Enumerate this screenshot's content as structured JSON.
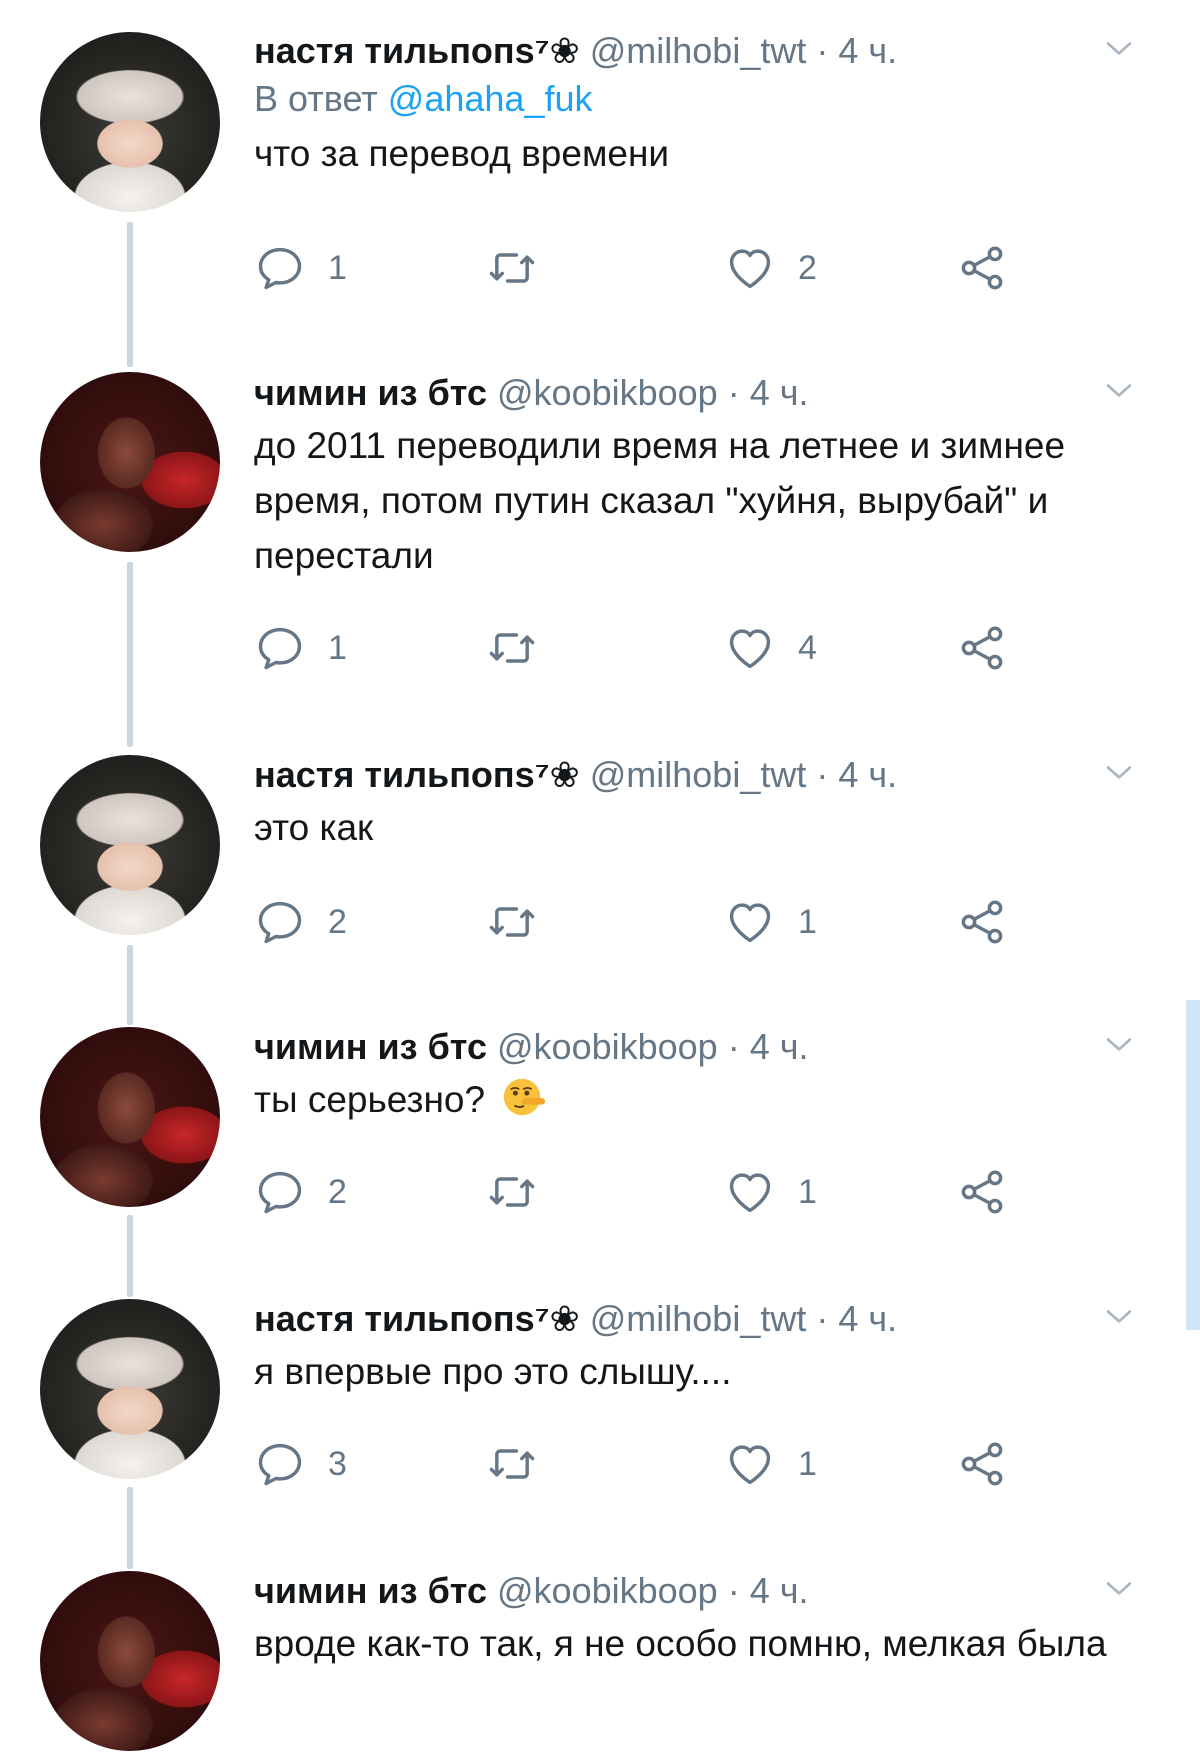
{
  "thread": {
    "tweets": [
      {
        "name": "настя тильпопs⁷❀",
        "handle": "@milhobi_twt",
        "time": "4 ч.",
        "dot": "·",
        "reply_prefix": "В ответ",
        "reply_mention": "@ahaha_fuk",
        "text": "что за перевод времени",
        "replies": "1",
        "retweets": "",
        "likes": "2",
        "avatar": "hobi"
      },
      {
        "name": "чимин из бтс",
        "handle": "@koobikboop",
        "time": "4 ч.",
        "dot": "·",
        "text": "до 2011 переводили время на летнее и зимнее время, потом путин сказал \"хуйня, вырубай\" и перестали",
        "replies": "1",
        "retweets": "",
        "likes": "4",
        "avatar": "jimin"
      },
      {
        "name": "настя тильпопs⁷❀",
        "handle": "@milhobi_twt",
        "time": "4 ч.",
        "dot": "·",
        "text": "это как",
        "replies": "2",
        "retweets": "",
        "likes": "1",
        "avatar": "hobi"
      },
      {
        "name": "чимин из бтс",
        "handle": "@koobikboop",
        "time": "4 ч.",
        "dot": "·",
        "text": "ты серьезно?",
        "emoji": "lying-face-emoji",
        "replies": "2",
        "retweets": "",
        "likes": "1",
        "avatar": "jimin"
      },
      {
        "name": "настя тильпопs⁷❀",
        "handle": "@milhobi_twt",
        "time": "4 ч.",
        "dot": "·",
        "text": "я впервые про это слышу....",
        "replies": "3",
        "retweets": "",
        "likes": "1",
        "avatar": "hobi"
      },
      {
        "name": "чимин из бтс",
        "handle": "@koobikboop",
        "time": "4 ч.",
        "dot": "·",
        "text": "вроде как-то так, я не особо помню, мелкая была",
        "replies": "",
        "retweets": "",
        "likes": "",
        "avatar": "jimin"
      }
    ]
  },
  "icons": {
    "reply": "reply-icon",
    "retweet": "retweet-icon",
    "like": "heart-icon",
    "share": "share-icon",
    "menu": "chevron-down-icon"
  },
  "colors": {
    "text": "#14171a",
    "secondary": "#657786",
    "link": "#1da1f2",
    "thread_line": "#ccd6dd"
  }
}
